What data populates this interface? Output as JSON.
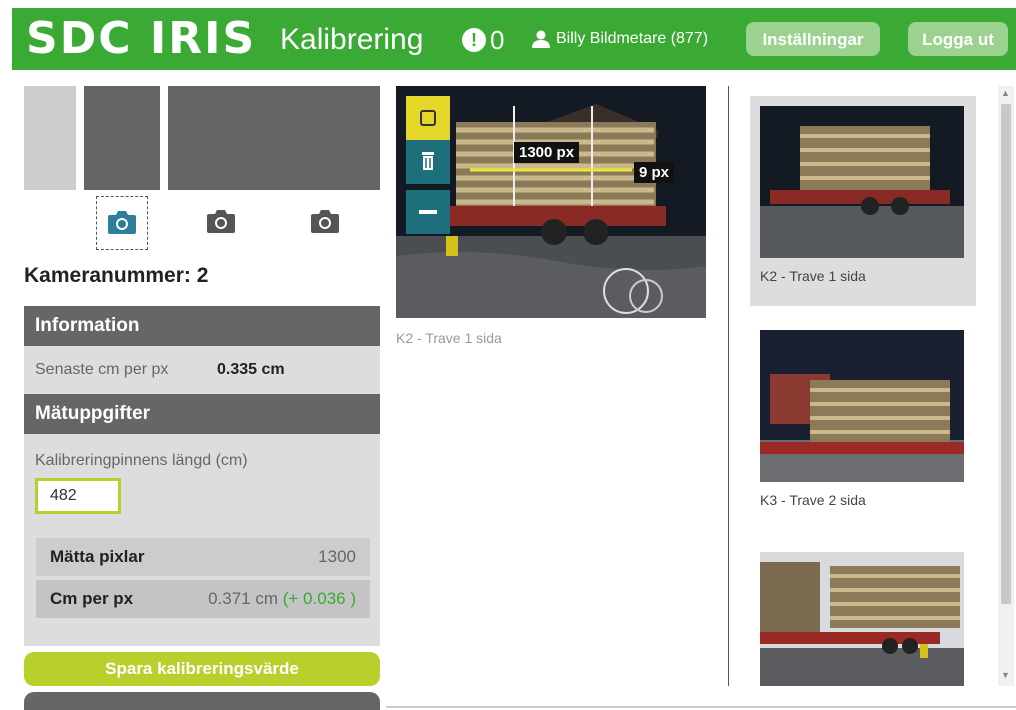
{
  "header": {
    "logo": "SDC IRIS",
    "page_title": "Kalibrering",
    "alert_count": "0",
    "user_name": "Billy Bildmetare (877)",
    "settings_label": "Inställningar",
    "logout_label": "Logga ut",
    "brand_color": "#3aaa35"
  },
  "left": {
    "camera_number_label": "Kameranummer: 2",
    "information": {
      "title": "Information",
      "latest_label": "Senaste cm per px",
      "latest_value": "0.335 cm"
    },
    "tasks": {
      "title": "Mätuppgifter",
      "pin_length_label": "Kalibreringpinnens längd (cm)",
      "pin_length_value": "482",
      "measure_pixels_label": "Mätta pixlar",
      "measure_pixels_value": "1300",
      "cm_per_px_label": "Cm per px",
      "cm_per_px_value": "0.371 cm",
      "cm_per_px_delta": "(+ 0.036 )"
    },
    "save_label": "Spara kalibreringsvärde"
  },
  "main": {
    "measure_length_label": "1300 px",
    "measure_thickness_label": "9 px",
    "caption": "K2 - Trave 1 sida"
  },
  "gallery": [
    {
      "caption": "K2 - Trave 1 sida"
    },
    {
      "caption": "K3 - Trave 2 sida"
    },
    {
      "caption": ""
    }
  ]
}
